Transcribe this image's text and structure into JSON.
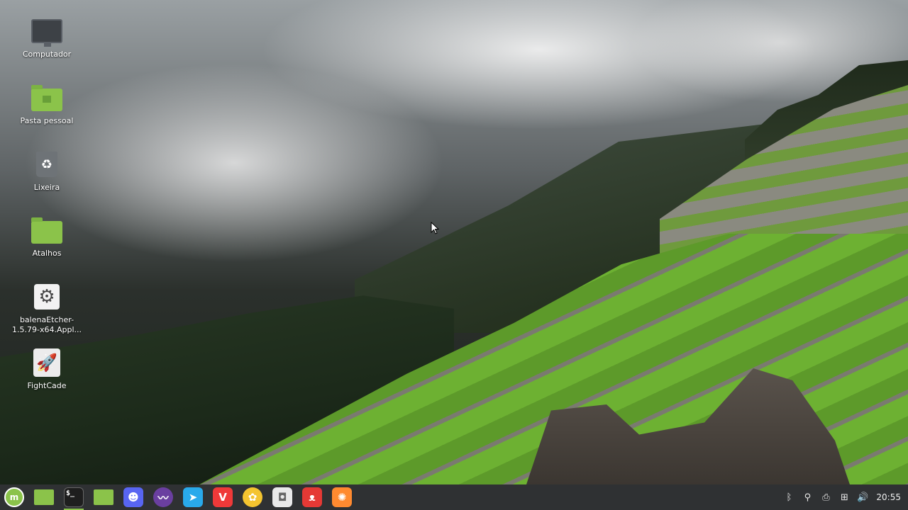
{
  "desktop": {
    "icons": [
      {
        "label": "Computador",
        "icon": "computer-icon"
      },
      {
        "label": "Pasta pessoal",
        "icon": "home-folder-icon"
      },
      {
        "label": "Lixeira",
        "icon": "trash-icon"
      },
      {
        "label": "Atalhos",
        "icon": "folder-icon"
      },
      {
        "label": "balenaEtcher-\n1.5.79-x64.Appl...",
        "icon": "gear-icon"
      },
      {
        "label": "FightCade",
        "icon": "rocket-icon"
      }
    ]
  },
  "taskbar": {
    "apps": [
      {
        "name": "linux-mint-menu",
        "color": "#8bc34a"
      },
      {
        "name": "show-desktop",
        "color": "#8bc34a"
      },
      {
        "name": "terminal",
        "color": "#1e1e1e",
        "glyph": "$_"
      },
      {
        "name": "files",
        "color": "#8bc34a"
      },
      {
        "name": "discord",
        "color": "#5865f2"
      },
      {
        "name": "mustache-app",
        "color": "#6a3fa0"
      },
      {
        "name": "telegram",
        "color": "#29a9eb"
      },
      {
        "name": "vivaldi",
        "color": "#ef3939"
      },
      {
        "name": "retroarch-like",
        "color": "#f4c430"
      },
      {
        "name": "software-manager",
        "color": "#e9e9e9"
      },
      {
        "name": "gimp-like",
        "color": "#e53935"
      },
      {
        "name": "firefox-like",
        "color": "#ff8a30"
      }
    ],
    "tray": {
      "icons": [
        "bluetooth-icon",
        "location-icon",
        "printer-icon",
        "network-icon",
        "volume-icon"
      ],
      "clock": "20:55"
    }
  }
}
